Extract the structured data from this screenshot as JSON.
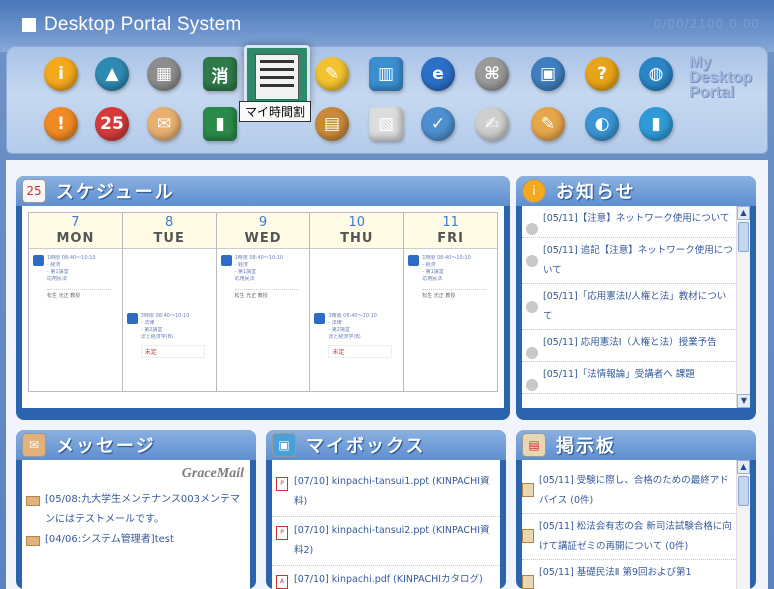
{
  "header": {
    "title": "Desktop Portal System",
    "info": "0/00/2100 0:00"
  },
  "toolbar": {
    "tooltip": "マイ時間割",
    "logo_line1": "My",
    "logo_line2": "Desktop",
    "logo_line3": "Portal",
    "row1": [
      {
        "name": "info-icon",
        "glyph": "i",
        "color": "#f4a81c"
      },
      {
        "name": "graduation-cap-icon",
        "glyph": "▲",
        "color": "#2d8ab0"
      },
      {
        "name": "building-icon",
        "glyph": "▦",
        "color": "#8d8d8d"
      },
      {
        "name": "blackboard-icon",
        "glyph": "消",
        "color": "#2e7a4a"
      },
      {
        "name": "notes-icon",
        "glyph": "✎",
        "color": "#f2c230"
      },
      {
        "name": "books-icon",
        "glyph": "▥",
        "color": "#3a8fd0"
      },
      {
        "name": "browser-icon",
        "glyph": "e",
        "color": "#2b6fc8"
      },
      {
        "name": "network-icon",
        "glyph": "⌘",
        "color": "#9a9a9a"
      },
      {
        "name": "kiosk-icon",
        "glyph": "▣",
        "color": "#3f7fc0"
      },
      {
        "name": "help-icon",
        "glyph": "?",
        "color": "#e8a418"
      },
      {
        "name": "globe-icon",
        "glyph": "◍",
        "color": "#2a86c6"
      }
    ],
    "row2": [
      {
        "name": "alert-icon",
        "glyph": "!",
        "color": "#f08a24"
      },
      {
        "name": "calendar-icon",
        "glyph": "25",
        "color": "#d33b3b"
      },
      {
        "name": "mail-icon",
        "glyph": "✉",
        "color": "#e8b070"
      },
      {
        "name": "door-icon",
        "glyph": "▮",
        "color": "#2a8a4a"
      },
      {
        "name": "bulletin-board-icon",
        "glyph": "▤",
        "color": "#c88a3a"
      },
      {
        "name": "documents-icon",
        "glyph": "▧",
        "color": "#dcdcdc"
      },
      {
        "name": "checklist-icon",
        "glyph": "✓",
        "color": "#4d8fcf"
      },
      {
        "name": "form-icon",
        "glyph": "✍",
        "color": "#cfcfcf"
      },
      {
        "name": "feedback-icon",
        "glyph": "✎",
        "color": "#e6a64a"
      },
      {
        "name": "earth-icon",
        "glyph": "◐",
        "color": "#3b94d3"
      },
      {
        "name": "chart-icon",
        "glyph": "▮",
        "color": "#2f9ad6"
      }
    ]
  },
  "schedule": {
    "title": "スケジュール",
    "days": [
      {
        "date": "7",
        "day": "MON"
      },
      {
        "date": "8",
        "day": "TUE"
      },
      {
        "date": "9",
        "day": "WED"
      },
      {
        "date": "10",
        "day": "THU"
      },
      {
        "date": "11",
        "day": "FRI"
      }
    ],
    "item_lines": [
      "1時限 08:40～10:10",
      "- 経済",
      "- 第1講堂",
      "応用民法"
    ],
    "teacher": "松生 光正 教授",
    "item2_lines": [
      "3時限 08:40～10:10",
      "- 法律",
      "- 第2講堂",
      "法と経済学(B)"
    ],
    "tag": "未定"
  },
  "notices": {
    "title": "お知らせ",
    "items": [
      "[05/11]【注意】ネットワーク使用について",
      "[05/11] 追記【注意】ネットワーク使用について",
      "[05/11]「応用憲法Ⅰ/人権と法」教材について",
      "[05/11] 応用憲法Ⅰ（人権と法）授業予告",
      "[05/11]「法情報論」受講者へ 課題"
    ]
  },
  "messages": {
    "title": "メッセージ",
    "brand": "GraceMail",
    "items": [
      "[05/08:九大学生メンテナンス003メンテマンにはテストメールです。",
      "[04/06:システム管理者]test"
    ]
  },
  "mybox": {
    "title": "マイボックス",
    "items": [
      "[07/10] kinpachi-tansui1.ppt (KINPACHI資料)",
      "[07/10] kinpachi-tansui2.ppt (KINPACHI資料2)",
      "[07/10] kinpachi.pdf (KINPACHIカタログ)"
    ]
  },
  "board": {
    "title": "掲示板",
    "items": [
      "[05/11] 受験に際し、合格のための最終アドバイス (0件)",
      "[05/11] 松法会有志の会 新司法試験合格に向けて講証ゼミの再開について (0件)",
      "[05/11] 基礎民法Ⅱ 第9回および第1"
    ]
  }
}
